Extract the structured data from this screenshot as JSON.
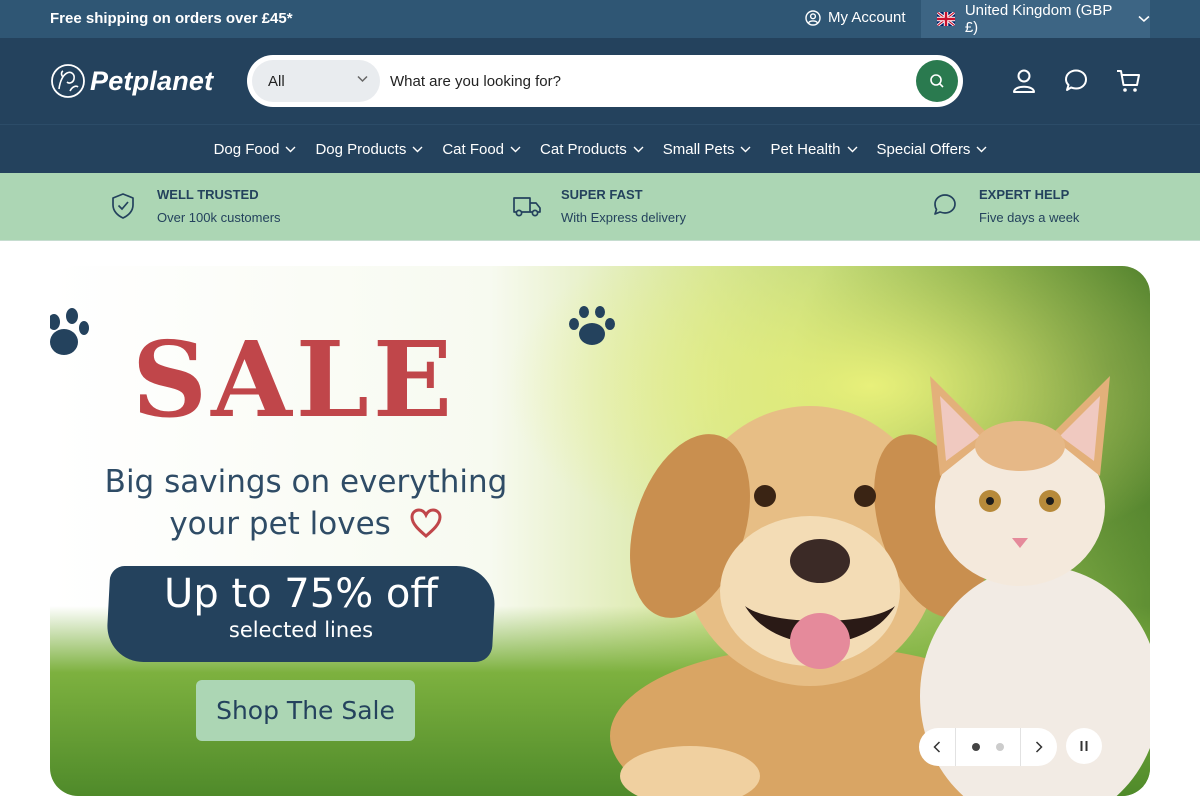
{
  "topbar": {
    "shipping_text": "Free shipping on orders over £45*",
    "account_label": "My Account",
    "country_label": "United Kingdom (GBP £)"
  },
  "header": {
    "logo_text": "Petplanet",
    "search": {
      "category_selected": "All",
      "placeholder": "What are you looking for?"
    },
    "icons": [
      "account-icon",
      "chat-icon",
      "cart-icon"
    ]
  },
  "nav": {
    "items": [
      {
        "label": "Dog Food"
      },
      {
        "label": "Dog Products"
      },
      {
        "label": "Cat Food"
      },
      {
        "label": "Cat Products"
      },
      {
        "label": "Small Pets"
      },
      {
        "label": "Pet Health"
      },
      {
        "label": "Special Offers"
      }
    ]
  },
  "trust": [
    {
      "title": "WELL TRUSTED",
      "subtitle": "Over 100k customers",
      "icon": "shield-check-icon"
    },
    {
      "title": "SUPER FAST",
      "subtitle": "With Express delivery",
      "icon": "truck-icon"
    },
    {
      "title": "EXPERT HELP",
      "subtitle": "Five days a week",
      "icon": "chat-icon"
    }
  ],
  "hero": {
    "headline": "SALE",
    "tagline_line1": "Big savings on everything",
    "tagline_line2": "your pet loves",
    "offer": "Up to 75% off",
    "offer_sub": "selected lines",
    "cta": "Shop The Sale",
    "slides_total": 2,
    "slide_active": 1
  },
  "colors": {
    "topbar": "#2f5674",
    "header": "#24425d",
    "trust_band": "#acd6b4",
    "search_button": "#2a7a4f",
    "sale_red": "#c0464a"
  }
}
